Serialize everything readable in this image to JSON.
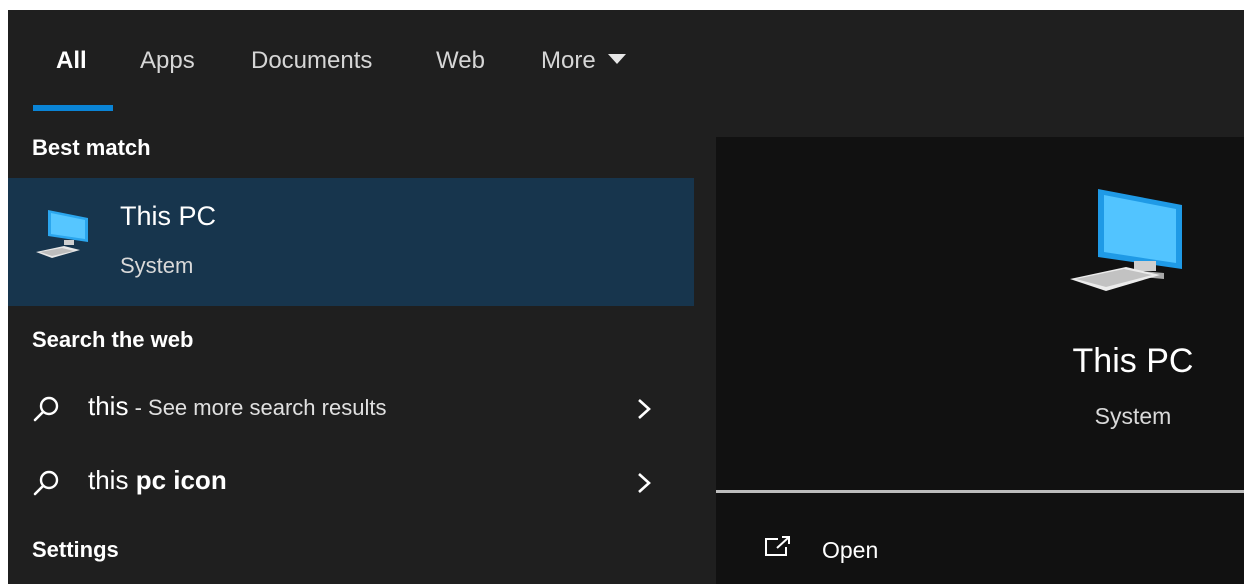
{
  "tabs": [
    {
      "label": "All",
      "active": true
    },
    {
      "label": "Apps",
      "active": false
    },
    {
      "label": "Documents",
      "active": false
    },
    {
      "label": "Web",
      "active": false
    },
    {
      "label": "More",
      "active": false
    }
  ],
  "accent_color": "#0a84d6",
  "selection_color": "#17354d",
  "sections": {
    "best_match": "Best match",
    "search_web": "Search the web",
    "settings": "Settings"
  },
  "best_match_item": {
    "title": "This PC",
    "subtitle": "System",
    "icon": "computer-icon"
  },
  "web_results": [
    {
      "term": "this",
      "suffix": " - See more search results",
      "icon": "search-icon"
    },
    {
      "prefix": "this ",
      "bold": "pc icon",
      "icon": "search-icon"
    }
  ],
  "preview": {
    "title": "This PC",
    "subtitle": "System",
    "action_label": "Open",
    "action_icon": "open-external-icon"
  }
}
